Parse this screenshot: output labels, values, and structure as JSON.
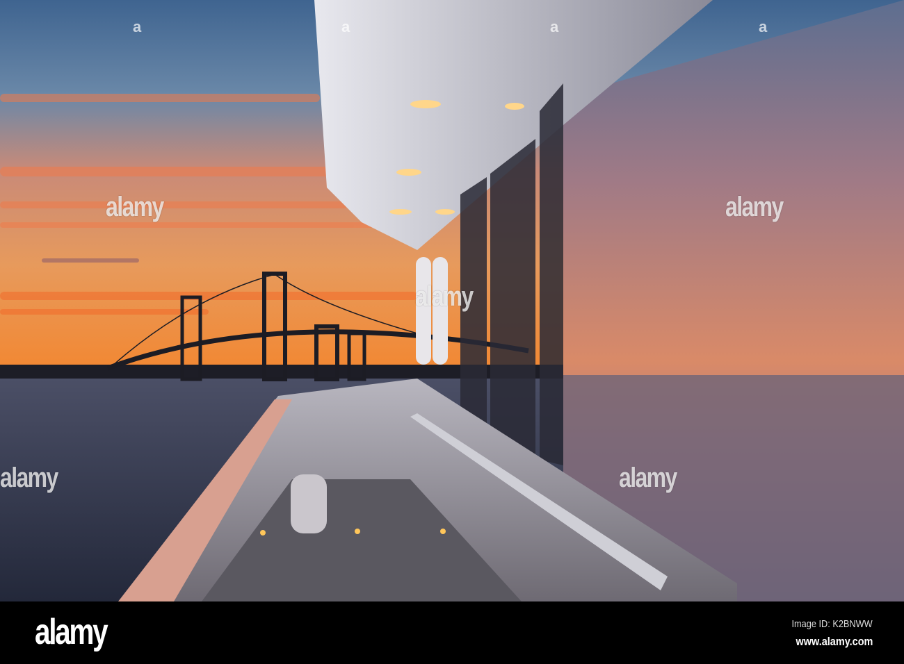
{
  "photo": {
    "subject": "Yacht deck at sunset with suspension bridge",
    "watermark_text": "alamy",
    "colors": {
      "sky_top": "#4b6f98",
      "sky_horizon": "#f0893a",
      "water": "#363b52",
      "hull": "#d9d9de"
    }
  },
  "footer": {
    "logo": "alamy",
    "image_id": "Image ID: K2BNWW",
    "url": "www.alamy.com"
  }
}
